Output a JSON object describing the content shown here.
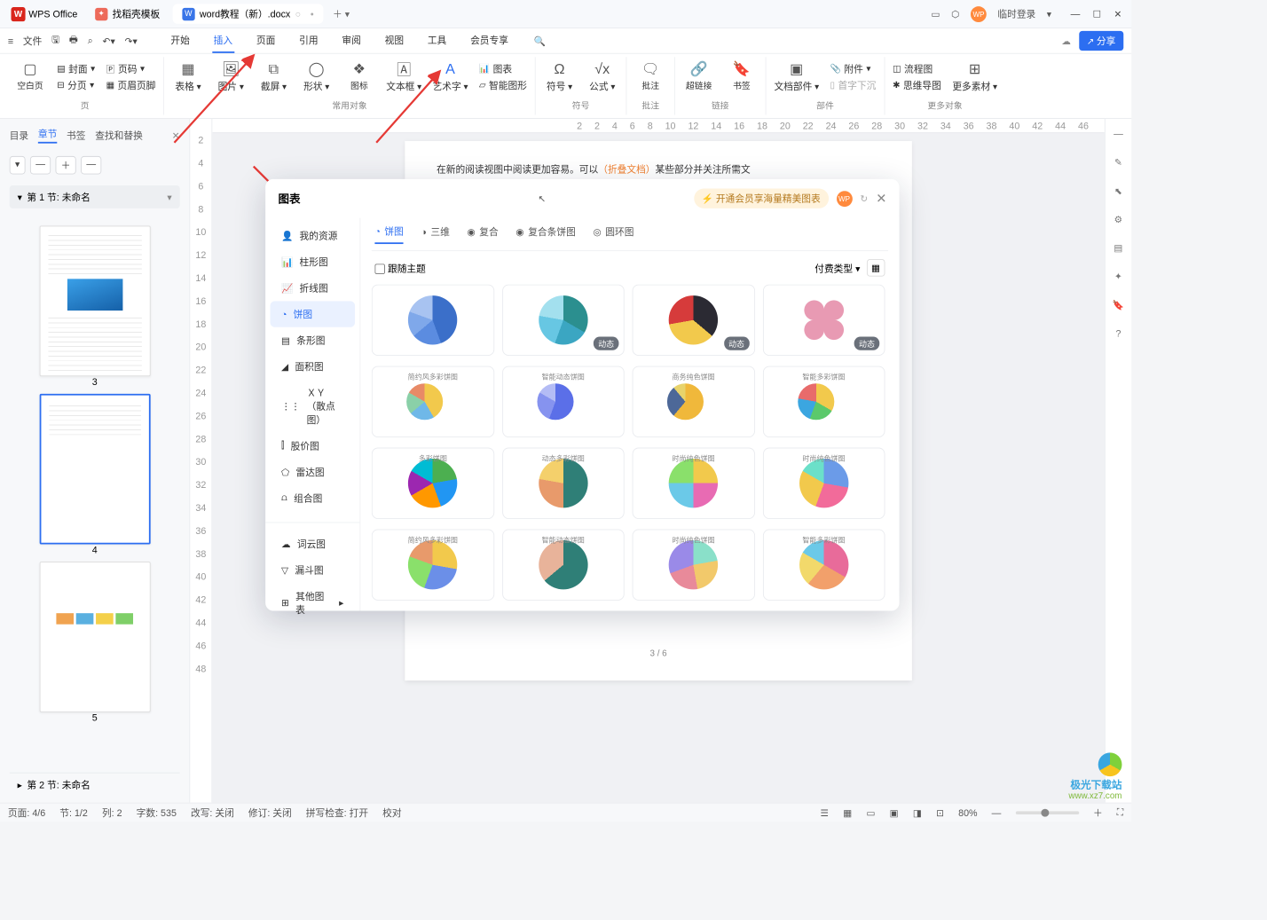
{
  "titlebar": {
    "brand": "WPS Office",
    "tabs": [
      {
        "icon": "skin",
        "label": "找稻壳模板"
      },
      {
        "icon": "word",
        "label": "word教程（新）.docx"
      }
    ],
    "login": "临时登录"
  },
  "menubar": {
    "file": "文件",
    "tabs": [
      "开始",
      "插入",
      "页面",
      "引用",
      "审阅",
      "视图",
      "工具",
      "会员专享"
    ],
    "active": "插入",
    "share": "分享"
  },
  "ribbon": {
    "g1": {
      "blank": "空白页",
      "cover": "封面",
      "pageno": "页码",
      "pagebreak": "分页",
      "header": "页眉页脚",
      "label": "页"
    },
    "g2": {
      "table": "表格",
      "image": "图片",
      "screenshot": "截屏",
      "shape": "形状",
      "icon": "图标",
      "textbox": "文本框",
      "wordart": "艺术字",
      "chart": "图表",
      "smart": "智能图形",
      "label": "常用对象"
    },
    "g3": {
      "symbol": "符号",
      "formula": "公式",
      "label": "符号"
    },
    "g4": {
      "annotate": "批注",
      "label": "批注"
    },
    "g5": {
      "link": "超链接",
      "bookmark": "书签",
      "label": "链接"
    },
    "g6": {
      "parts": "文档部件",
      "attach": "附件",
      "dropcap": "首字下沉",
      "label": "部件"
    },
    "g7": {
      "flow": "流程图",
      "mind": "思维导图",
      "more": "更多素材",
      "label": "更多对象"
    }
  },
  "nav": {
    "tabs": [
      "目录",
      "章节",
      "书签",
      "查找和替换"
    ],
    "active": "章节",
    "section1": "第 1 节: 未命名",
    "section2": "第 2 节: 未命名",
    "pages": [
      "3",
      "4",
      "5"
    ]
  },
  "ruler": [
    "2",
    "2",
    "4",
    "6",
    "8",
    "10",
    "12",
    "14",
    "16",
    "18",
    "20",
    "22",
    "24",
    "26",
    "28",
    "30",
    "32",
    "34",
    "36",
    "38",
    "40",
    "42",
    "44",
    "46"
  ],
  "vruler": [
    "2",
    "4",
    "6",
    "8",
    "10",
    "12",
    "14",
    "16",
    "18",
    "20",
    "22",
    "24",
    "26",
    "28",
    "30",
    "32",
    "34",
    "36",
    "38",
    "40",
    "42",
    "44",
    "46",
    "48"
  ],
  "doc": {
    "line1_a": "在新的阅读视图中阅读更加容易。可以",
    "line1_b": "（折叠文档）",
    "line1_c": "某些部分并关注所需文",
    "pagenum": "3 / 6"
  },
  "popup": {
    "title": "图表",
    "vip": "开通会员享海量精美图表",
    "side": [
      "我的资源",
      "柱形图",
      "折线图",
      "饼图",
      "条形图",
      "面积图",
      "ＸＹ（散点图）",
      "股价图",
      "雷达图",
      "组合图"
    ],
    "side2": [
      "词云图",
      "漏斗图",
      "其他图表"
    ],
    "side_active": "饼图",
    "tabs": [
      "饼图",
      "三维",
      "复合",
      "复合条饼图",
      "圆环图"
    ],
    "tab_active": "饼图",
    "follow": "跟随主题",
    "filter": "付费类型",
    "badge": "动态",
    "card_titles": [
      "",
      "",
      "",
      "",
      "简约风多彩饼图",
      "智能动态饼图",
      "商务纯色饼图",
      "智能多彩饼图",
      "多彩饼图",
      "动态多彩饼图",
      "时尚纯色饼图",
      "时尚纯色饼图",
      "简约风多彩饼图",
      "智能动态饼图",
      "时尚纯色饼图",
      "智能多彩饼图"
    ]
  },
  "status": {
    "page": "页面: 4/6",
    "section": "节: 1/2",
    "col": "列: 2",
    "chars": "字数: 535",
    "rev": "改写: 关闭",
    "edit": "修订: 关闭",
    "spell": "拼写检查: 打开",
    "proof": "校对",
    "zoom": "80%"
  },
  "watermark": {
    "t1": "极光下载站",
    "t2": "www.xz7.com"
  }
}
